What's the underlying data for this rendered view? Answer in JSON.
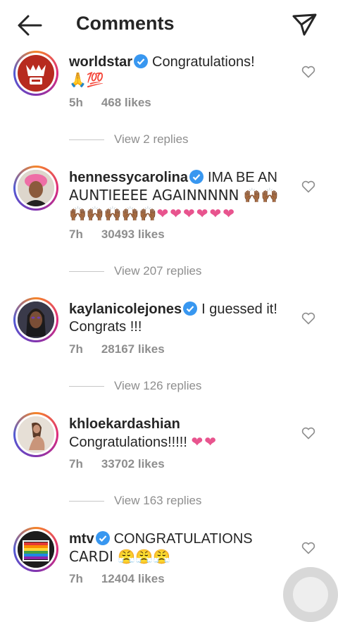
{
  "header": {
    "title": "Comments"
  },
  "comments": [
    {
      "user": "worldstar",
      "line1": "Congratulations!",
      "line2": "🙏💯",
      "time": "5h",
      "likes": "468 likes",
      "replies": "View 2 replies"
    },
    {
      "user": "hennessycarolina",
      "line1": "IMA BE AN",
      "line2": "AUNTIEEEE AGAINNNNN 🙌🏾🙌🏾",
      "line3": "🙌🏾🙌🏾🙌🏾🙌🏾🙌🏾",
      "hearts": "❤❤❤❤❤❤",
      "time": "7h",
      "likes": "30493 likes",
      "replies": "View 207 replies"
    },
    {
      "user": "kaylanicolejones",
      "line1": "I guessed it!",
      "line2": "Congrats !!!",
      "time": "7h",
      "likes": "28167 likes",
      "replies": "View 126 replies"
    },
    {
      "user": "khloekardashian",
      "line1": "Congratulations!!!!!",
      "hearts": "❤❤",
      "time": "7h",
      "likes": "33702 likes",
      "replies": "View 163 replies"
    },
    {
      "user": "mtv",
      "line1": "CONGRATULATIONS",
      "line2": "CARDI 😤😤😤",
      "time": "7h",
      "likes": "12404 likes"
    }
  ],
  "colors": {
    "verified": "#3897f0",
    "meta": "#8e8e8e",
    "heart_emoji": "#e8548e"
  },
  "icons": [
    "back-arrow-icon",
    "send-icon",
    "verified-icon",
    "heart-outline-icon"
  ]
}
